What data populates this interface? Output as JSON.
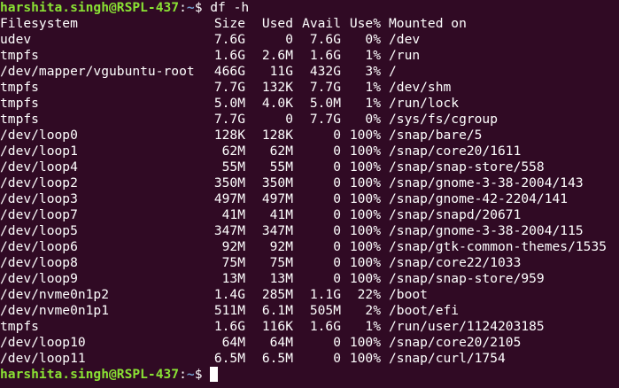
{
  "prompt": {
    "user_host": "harshita.singh@RSPL-437",
    "colon": ":",
    "path": "~",
    "symbol": "$ ",
    "command": "df -h"
  },
  "table": {
    "headers": {
      "filesystem": "Filesystem",
      "size": "Size",
      "used": "Used",
      "avail": "Avail",
      "use_pct": "Use%",
      "mounted": "Mounted on"
    },
    "rows": [
      {
        "fs": "udev",
        "size": "7.6G",
        "used": "0",
        "avail": "7.6G",
        "use": "0%",
        "mount": "/dev"
      },
      {
        "fs": "tmpfs",
        "size": "1.6G",
        "used": "2.6M",
        "avail": "1.6G",
        "use": "1%",
        "mount": "/run"
      },
      {
        "fs": "/dev/mapper/vgubuntu-root",
        "size": "466G",
        "used": "11G",
        "avail": "432G",
        "use": "3%",
        "mount": "/"
      },
      {
        "fs": "tmpfs",
        "size": "7.7G",
        "used": "132K",
        "avail": "7.7G",
        "use": "1%",
        "mount": "/dev/shm"
      },
      {
        "fs": "tmpfs",
        "size": "5.0M",
        "used": "4.0K",
        "avail": "5.0M",
        "use": "1%",
        "mount": "/run/lock"
      },
      {
        "fs": "tmpfs",
        "size": "7.7G",
        "used": "0",
        "avail": "7.7G",
        "use": "0%",
        "mount": "/sys/fs/cgroup"
      },
      {
        "fs": "/dev/loop0",
        "size": "128K",
        "used": "128K",
        "avail": "0",
        "use": "100%",
        "mount": "/snap/bare/5"
      },
      {
        "fs": "/dev/loop1",
        "size": "62M",
        "used": "62M",
        "avail": "0",
        "use": "100%",
        "mount": "/snap/core20/1611"
      },
      {
        "fs": "/dev/loop4",
        "size": "55M",
        "used": "55M",
        "avail": "0",
        "use": "100%",
        "mount": "/snap/snap-store/558"
      },
      {
        "fs": "/dev/loop2",
        "size": "350M",
        "used": "350M",
        "avail": "0",
        "use": "100%",
        "mount": "/snap/gnome-3-38-2004/143"
      },
      {
        "fs": "/dev/loop3",
        "size": "497M",
        "used": "497M",
        "avail": "0",
        "use": "100%",
        "mount": "/snap/gnome-42-2204/141"
      },
      {
        "fs": "/dev/loop7",
        "size": "41M",
        "used": "41M",
        "avail": "0",
        "use": "100%",
        "mount": "/snap/snapd/20671"
      },
      {
        "fs": "/dev/loop5",
        "size": "347M",
        "used": "347M",
        "avail": "0",
        "use": "100%",
        "mount": "/snap/gnome-3-38-2004/115"
      },
      {
        "fs": "/dev/loop6",
        "size": "92M",
        "used": "92M",
        "avail": "0",
        "use": "100%",
        "mount": "/snap/gtk-common-themes/1535"
      },
      {
        "fs": "/dev/loop8",
        "size": "75M",
        "used": "75M",
        "avail": "0",
        "use": "100%",
        "mount": "/snap/core22/1033"
      },
      {
        "fs": "/dev/loop9",
        "size": "13M",
        "used": "13M",
        "avail": "0",
        "use": "100%",
        "mount": "/snap/snap-store/959"
      },
      {
        "fs": "/dev/nvme0n1p2",
        "size": "1.4G",
        "used": "285M",
        "avail": "1.1G",
        "use": "22%",
        "mount": "/boot"
      },
      {
        "fs": "/dev/nvme0n1p1",
        "size": "511M",
        "used": "6.1M",
        "avail": "505M",
        "use": "2%",
        "mount": "/boot/efi"
      },
      {
        "fs": "tmpfs",
        "size": "1.6G",
        "used": "116K",
        "avail": "1.6G",
        "use": "1%",
        "mount": "/run/user/1124203185"
      },
      {
        "fs": "/dev/loop10",
        "size": "64M",
        "used": "64M",
        "avail": "0",
        "use": "100%",
        "mount": "/snap/core20/2105"
      },
      {
        "fs": "/dev/loop11",
        "size": "6.5M",
        "used": "6.5M",
        "avail": "0",
        "use": "100%",
        "mount": "/snap/curl/1754"
      }
    ]
  },
  "colors": {
    "background": "#300a24",
    "user_host": "#8ae234",
    "path": "#729fcf",
    "text": "#ffffff"
  }
}
